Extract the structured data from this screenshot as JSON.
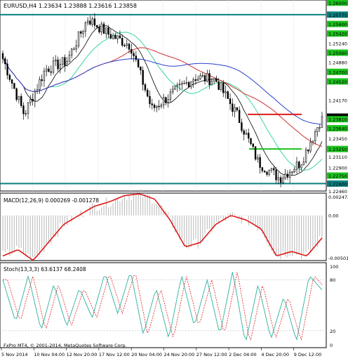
{
  "header": {
    "symbol_title": "EURUSD,H4",
    "ohlc": "1.23634 1.23888 1.23616 1.23858"
  },
  "price_axis": {
    "labels": [
      "1.26000",
      "1.25775",
      "1.25600",
      "1.25420",
      "1.25240",
      "1.25060",
      "1.24880",
      "1.24700",
      "1.24520",
      "1.24170",
      "1.23858",
      "1.23810",
      "1.23640",
      "1.23450",
      "1.23250",
      "1.23110",
      "1.22900",
      "1.22750",
      "1.22600",
      "1.22460"
    ],
    "highlighted": [
      {
        "value": 1.26,
        "label": "1.26000",
        "color": "#1cc21c"
      },
      {
        "value": 1.25775,
        "label": "1.25775",
        "color": "#0a7f7f"
      },
      {
        "value": 1.256,
        "label": "1.25600",
        "color": "#1cc21c"
      },
      {
        "value": 1.2542,
        "label": "1.25420",
        "color": "#1cc21c"
      },
      {
        "value": 1.2506,
        "label": "1.25060",
        "color": "#1cc21c"
      },
      {
        "value": 1.247,
        "label": "1.24700",
        "color": "#1cc21c"
      },
      {
        "value": 1.2452,
        "label": "1.24520",
        "color": "#1cc21c"
      },
      {
        "value": 1.23858,
        "label": "1.23858",
        "color": "#000000"
      },
      {
        "value": 1.2381,
        "label": "1.23810",
        "color": "#1cc21c"
      },
      {
        "value": 1.2364,
        "label": "1.23640",
        "color": "#1cc21c"
      },
      {
        "value": 1.2325,
        "label": "1.23250",
        "color": "#1cc21c"
      },
      {
        "value": 1.2275,
        "label": "1.22750",
        "color": "#1cc21c"
      },
      {
        "value": 1.226,
        "label": "1.22600",
        "color": "#0a7f7f"
      }
    ]
  },
  "macd_panel": {
    "title": "MACD(12,26,9) 0.000269 -0.001278",
    "axis_labels": [
      "0.002473",
      "0.00",
      "-0.005012"
    ]
  },
  "stoch_panel": {
    "title": "Stoch(13,3,3) 63.6137 68.2408",
    "axis_labels": [
      "100",
      "80",
      "20",
      "0"
    ]
  },
  "time_axis": {
    "labels": [
      "5 Nov 2014",
      "10 Nov 04:00",
      "12 Nov 20:00",
      "17 Nov 12:00",
      "20 Nov 04:00",
      "24 Nov 20:00",
      "27 Nov 12:00",
      "2 Dec 04:00",
      "4 Dec 20:00",
      "9 Dec 12:00"
    ]
  },
  "footer": {
    "copyright": "FxPro MT4, © 2001-2014, MetaQuotes Software Corp."
  },
  "colors": {
    "up_candle": "#ffffff",
    "down_candle": "#000000",
    "ma_fast": "#000000",
    "ma_medium": "#3cd69a",
    "ma_red": "#d03030",
    "ma_blue": "#2a3fd0",
    "level_teal": "#0a7f7f",
    "level_green": "#1cc21c",
    "level_red": "#e01b1b",
    "macd_signal": "#e01b1b",
    "macd_hist": "#b8b8b8",
    "stoch_main": "#3cb8a8",
    "stoch_signal": "#e01b1b"
  },
  "chart_data": {
    "type": "line",
    "symbol": "EURUSD",
    "timeframe": "H4",
    "price_range": [
      1.2246,
      1.2605
    ],
    "horizontal_levels": [
      {
        "value": 1.25775,
        "color": "teal"
      },
      {
        "value": 1.226,
        "color": "teal"
      },
      {
        "value": 1.239,
        "color": "red"
      },
      {
        "value": 1.2325,
        "color": "green"
      }
    ],
    "price_path": [
      {
        "x": "5 Nov 2014",
        "close": 1.2495
      },
      {
        "x": "7 Nov",
        "close": 1.239
      },
      {
        "x": "10 Nov 04:00",
        "close": 1.2475
      },
      {
        "x": "12 Nov 20:00",
        "close": 1.249
      },
      {
        "x": "17 Nov 12:00",
        "close": 1.257
      },
      {
        "x": "19 Nov",
        "close": 1.254
      },
      {
        "x": "20 Nov 04:00",
        "close": 1.252
      },
      {
        "x": "21 Nov",
        "close": 1.24
      },
      {
        "x": "24 Nov 20:00",
        "close": 1.243
      },
      {
        "x": "27 Nov 12:00",
        "close": 1.246
      },
      {
        "x": "28 Nov",
        "close": 1.2455
      },
      {
        "x": "2 Dec 04:00",
        "close": 1.239
      },
      {
        "x": "3 Dec",
        "close": 1.23
      },
      {
        "x": "4 Dec 20:00",
        "close": 1.227
      },
      {
        "x": "8 Dec",
        "close": 1.23
      },
      {
        "x": "9 Dec 12:00",
        "close": 1.23858
      }
    ],
    "macd": {
      "range": [
        -0.005012,
        0.002473
      ],
      "signal": [
        -0.0045,
        -0.0038,
        -0.005,
        -0.003,
        -0.001,
        0.0,
        0.001,
        0.0015,
        0.0022,
        0.0024,
        0.0018,
        -0.0005,
        -0.0035,
        -0.003,
        -0.001,
        0.0,
        -0.0005,
        -0.0015,
        -0.0045,
        -0.004,
        -0.0045,
        -0.0025
      ]
    },
    "stochastic": {
      "range": [
        0,
        100
      ],
      "levels": [
        80,
        20
      ],
      "main": [
        80,
        30,
        85,
        20,
        75,
        25,
        70,
        35,
        88,
        40,
        90,
        15,
        70,
        10,
        85,
        25,
        80,
        15,
        90,
        5,
        75,
        10,
        60,
        8,
        85,
        68
      ]
    }
  }
}
